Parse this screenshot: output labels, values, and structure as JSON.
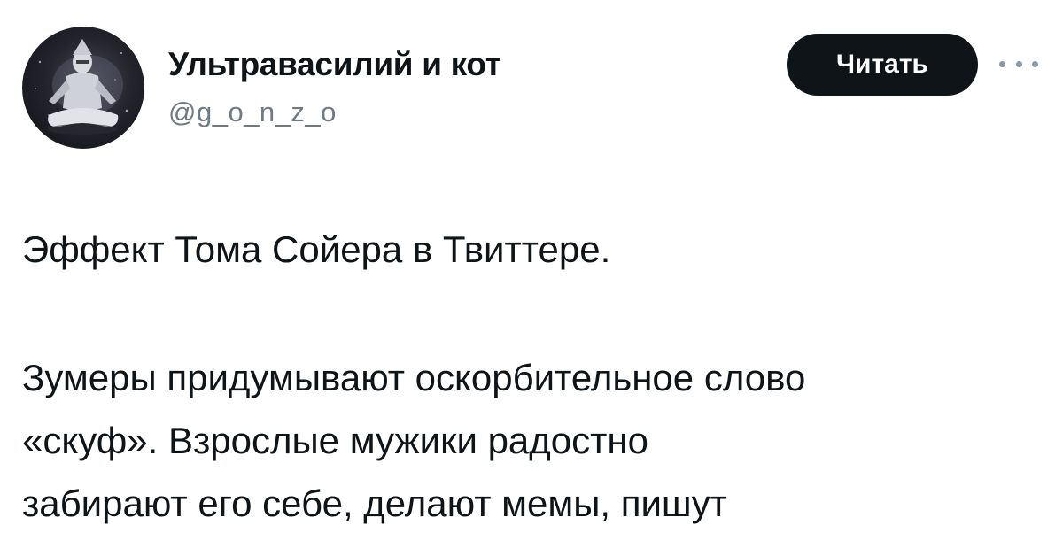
{
  "author": {
    "display_name": "Ультравасилий и кот",
    "handle": "@g_o_n_z_o",
    "avatar_icon": "meditating-figure-avatar"
  },
  "actions": {
    "follow_label": "Читать",
    "more_icon": "more-options-icon"
  },
  "tweet": {
    "lines": [
      "Эффект Тома Сойера в Твиттере.",
      "Зумеры придумывают оскорбительное слово",
      "«скуф». Взрослые мужики радостно",
      "забирают его себе, делают мемы, пишут"
    ]
  },
  "colors": {
    "text": "#0f1419",
    "secondary_text": "#6e7a86",
    "button_bg": "#0f1419",
    "button_text": "#ffffff"
  }
}
